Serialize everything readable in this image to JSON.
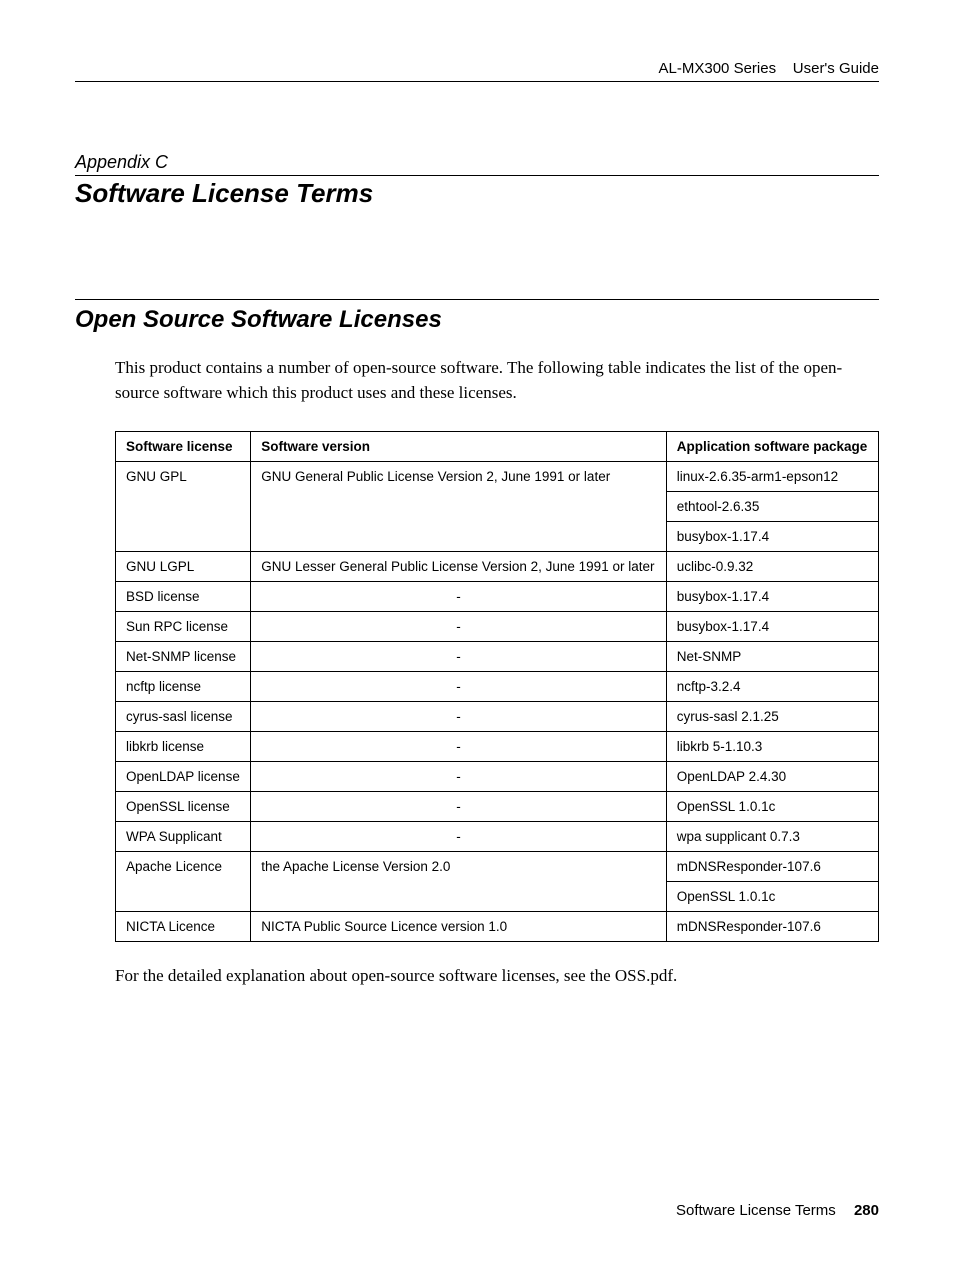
{
  "header": {
    "product": "AL-MX300 Series",
    "doc": "User's Guide"
  },
  "appendix": {
    "label": "Appendix C",
    "title": "Software License Terms"
  },
  "section": {
    "title": "Open Source Software Licenses",
    "intro": "This product contains a number of open-source software. The following table indicates the list of the open-source software which this product uses and these licenses.",
    "outro": "For the detailed explanation about open-source software licenses, see the OSS.pdf."
  },
  "table": {
    "headers": {
      "c1": "Software license",
      "c2": "Software version",
      "c3": "Application software package"
    },
    "rows": [
      {
        "license": "GNU GPL",
        "version": "GNU General Public License Version 2, June 1991 or later",
        "packages": [
          "linux-2.6.35-arm1-epson12",
          "ethtool-2.6.35",
          "busybox-1.17.4"
        ],
        "version_align": "left"
      },
      {
        "license": "GNU LGPL",
        "version": "GNU Lesser General Public License Version 2, June 1991 or later",
        "packages": [
          "uclibc-0.9.32"
        ],
        "version_align": "left"
      },
      {
        "license": "BSD license",
        "version": "-",
        "packages": [
          "busybox-1.17.4"
        ],
        "version_align": "center"
      },
      {
        "license": "Sun RPC license",
        "version": "-",
        "packages": [
          "busybox-1.17.4"
        ],
        "version_align": "center"
      },
      {
        "license": "Net-SNMP license",
        "version": "-",
        "packages": [
          "Net-SNMP"
        ],
        "version_align": "center"
      },
      {
        "license": "ncftp license",
        "version": "-",
        "packages": [
          "ncftp-3.2.4"
        ],
        "version_align": "center"
      },
      {
        "license": "cyrus-sasl license",
        "version": "-",
        "packages": [
          "cyrus-sasl 2.1.25"
        ],
        "version_align": "center"
      },
      {
        "license": "libkrb license",
        "version": "-",
        "packages": [
          "libkrb 5-1.10.3"
        ],
        "version_align": "center"
      },
      {
        "license": "OpenLDAP license",
        "version": "-",
        "packages": [
          "OpenLDAP 2.4.30"
        ],
        "version_align": "center"
      },
      {
        "license": "OpenSSL license",
        "version": "-",
        "packages": [
          "OpenSSL 1.0.1c"
        ],
        "version_align": "center"
      },
      {
        "license": "WPA Supplicant",
        "version": "-",
        "packages": [
          "wpa supplicant 0.7.3"
        ],
        "version_align": "center"
      },
      {
        "license": "Apache Licence",
        "version": "the Apache License Version 2.0",
        "packages": [
          "mDNSResponder-107.6",
          "OpenSSL 1.0.1c"
        ],
        "version_align": "left"
      },
      {
        "license": "NICTA Licence",
        "version": "NICTA Public Source Licence version 1.0",
        "packages": [
          "mDNSResponder-107.6"
        ],
        "version_align": "left"
      }
    ]
  },
  "footer": {
    "section": "Software License Terms",
    "page": "280"
  }
}
